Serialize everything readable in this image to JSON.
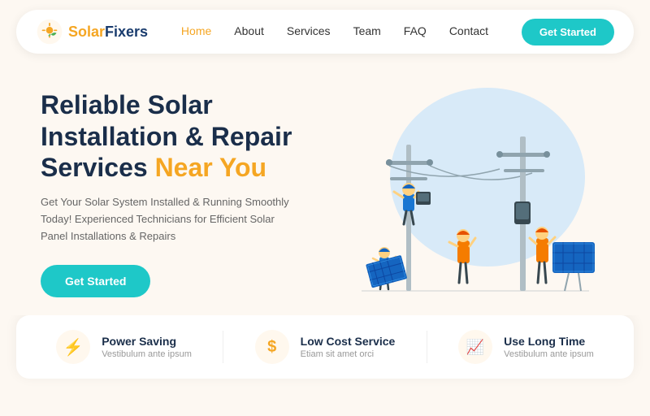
{
  "brand": {
    "name_solar": "Solar",
    "name_fixers": "Fixers"
  },
  "navbar": {
    "links": [
      {
        "label": "Home",
        "active": true
      },
      {
        "label": "About",
        "active": false
      },
      {
        "label": "Services",
        "active": false
      },
      {
        "label": "Team",
        "active": false
      },
      {
        "label": "FAQ",
        "active": false
      },
      {
        "label": "Contact",
        "active": false
      }
    ],
    "cta_label": "Get Started"
  },
  "hero": {
    "title_line1": "Reliable Solar",
    "title_line2": "Installation & Repair",
    "title_line3": "Services",
    "title_highlight": "Near You",
    "description": "Get Your Solar System Installed & Running Smoothly Today! Experienced Technicians for Efficient Solar Panel Installations & Repairs",
    "cta_label": "Get Started"
  },
  "features": [
    {
      "icon": "⚡",
      "title": "Power Saving",
      "subtitle": "Vestibulum ante ipsum"
    },
    {
      "icon": "$",
      "title": "Low Cost Service",
      "subtitle": "Etiam sit amet orci"
    },
    {
      "icon": "📈",
      "title": "Use Long Time",
      "subtitle": "Vestibulum ante ipsum"
    }
  ]
}
